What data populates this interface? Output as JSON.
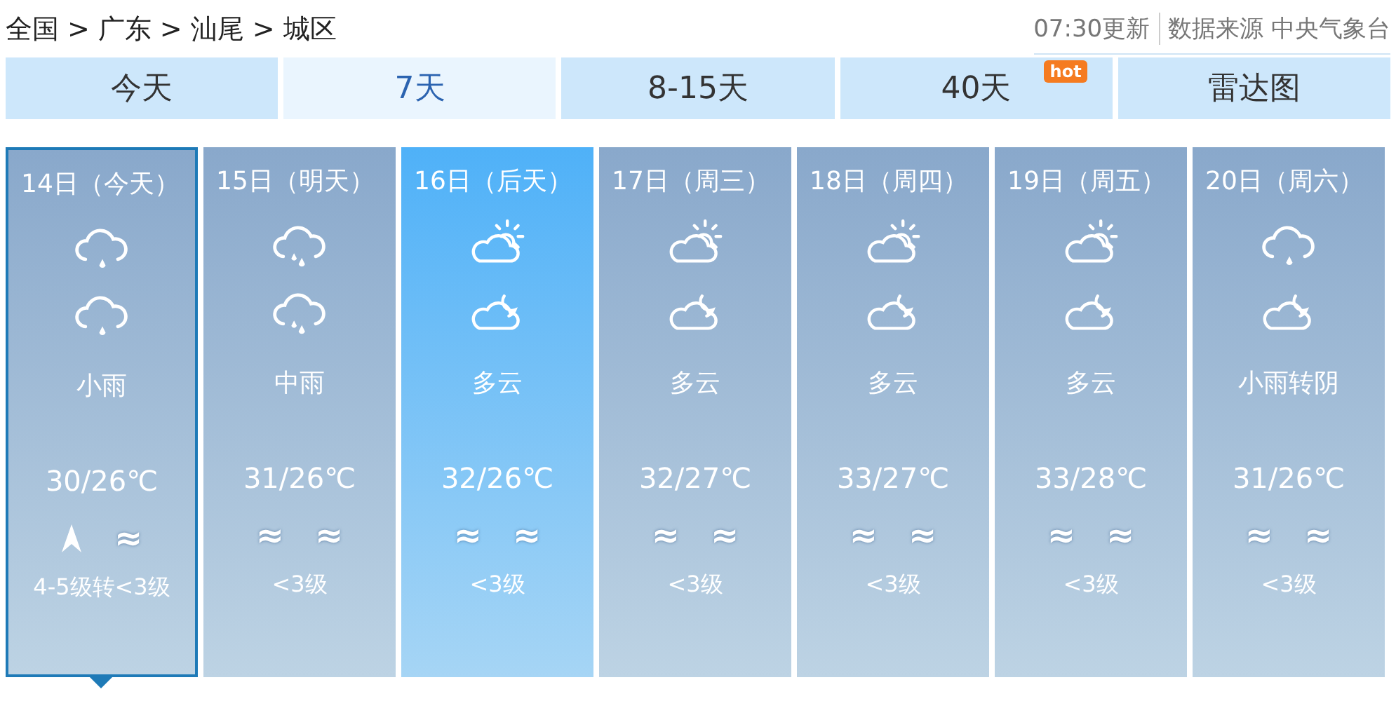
{
  "breadcrumb": [
    "全国",
    "广东",
    "汕尾",
    "城区"
  ],
  "breadcrumb_separator": ">",
  "update_time": "07:30更新",
  "source": "数据来源 中央气象台",
  "tabs": [
    {
      "label": "今天",
      "selected": false
    },
    {
      "label": "7天",
      "selected": true
    },
    {
      "label": "8-15天",
      "selected": false
    },
    {
      "label": "40天",
      "selected": false,
      "badge": "hot"
    },
    {
      "label": "雷达图",
      "selected": false
    }
  ],
  "days": [
    {
      "date": "14日（今天）",
      "selected": true,
      "highlighted": false,
      "icons": [
        {
          "kind": "light_rain"
        },
        {
          "kind": "light_rain"
        }
      ],
      "weather": "小雨",
      "temp": "30/26℃",
      "wind": [
        {
          "kind": "arrow"
        },
        {
          "kind": "calm",
          "symbol": "≈"
        }
      ],
      "wind_level": "4-5级转<3级"
    },
    {
      "date": "15日（明天）",
      "selected": false,
      "highlighted": false,
      "icons": [
        {
          "kind": "moderate_rain"
        },
        {
          "kind": "moderate_rain"
        }
      ],
      "weather": "中雨",
      "temp": "31/26℃",
      "wind": [
        {
          "kind": "calm",
          "symbol": "≈"
        },
        {
          "kind": "calm",
          "symbol": "≈"
        }
      ],
      "wind_level": "<3级"
    },
    {
      "date": "16日（后天）",
      "selected": false,
      "highlighted": true,
      "icons": [
        {
          "kind": "cloudy_day"
        },
        {
          "kind": "cloudy_night"
        }
      ],
      "weather": "多云",
      "temp": "32/26℃",
      "wind": [
        {
          "kind": "calm",
          "symbol": "≈"
        },
        {
          "kind": "calm",
          "symbol": "≈"
        }
      ],
      "wind_level": "<3级"
    },
    {
      "date": "17日（周三）",
      "selected": false,
      "highlighted": false,
      "icons": [
        {
          "kind": "cloudy_day"
        },
        {
          "kind": "cloudy_night"
        }
      ],
      "weather": "多云",
      "temp": "32/27℃",
      "wind": [
        {
          "kind": "calm",
          "symbol": "≈"
        },
        {
          "kind": "calm",
          "symbol": "≈"
        }
      ],
      "wind_level": "<3级"
    },
    {
      "date": "18日（周四）",
      "selected": false,
      "highlighted": false,
      "icons": [
        {
          "kind": "cloudy_day"
        },
        {
          "kind": "cloudy_night"
        }
      ],
      "weather": "多云",
      "temp": "33/27℃",
      "wind": [
        {
          "kind": "calm",
          "symbol": "≈"
        },
        {
          "kind": "calm",
          "symbol": "≈"
        }
      ],
      "wind_level": "<3级"
    },
    {
      "date": "19日（周五）",
      "selected": false,
      "highlighted": false,
      "icons": [
        {
          "kind": "cloudy_day"
        },
        {
          "kind": "cloudy_night"
        }
      ],
      "weather": "多云",
      "temp": "33/28℃",
      "wind": [
        {
          "kind": "calm",
          "symbol": "≈"
        },
        {
          "kind": "calm",
          "symbol": "≈"
        }
      ],
      "wind_level": "<3级"
    },
    {
      "date": "20日（周六）",
      "selected": false,
      "highlighted": false,
      "icons": [
        {
          "kind": "light_rain"
        },
        {
          "kind": "cloudy_night"
        }
      ],
      "weather": "小雨转阴",
      "temp": "31/26℃",
      "wind": [
        {
          "kind": "calm",
          "symbol": "≈"
        },
        {
          "kind": "calm",
          "symbol": "≈"
        }
      ],
      "wind_level": "<3级"
    }
  ]
}
